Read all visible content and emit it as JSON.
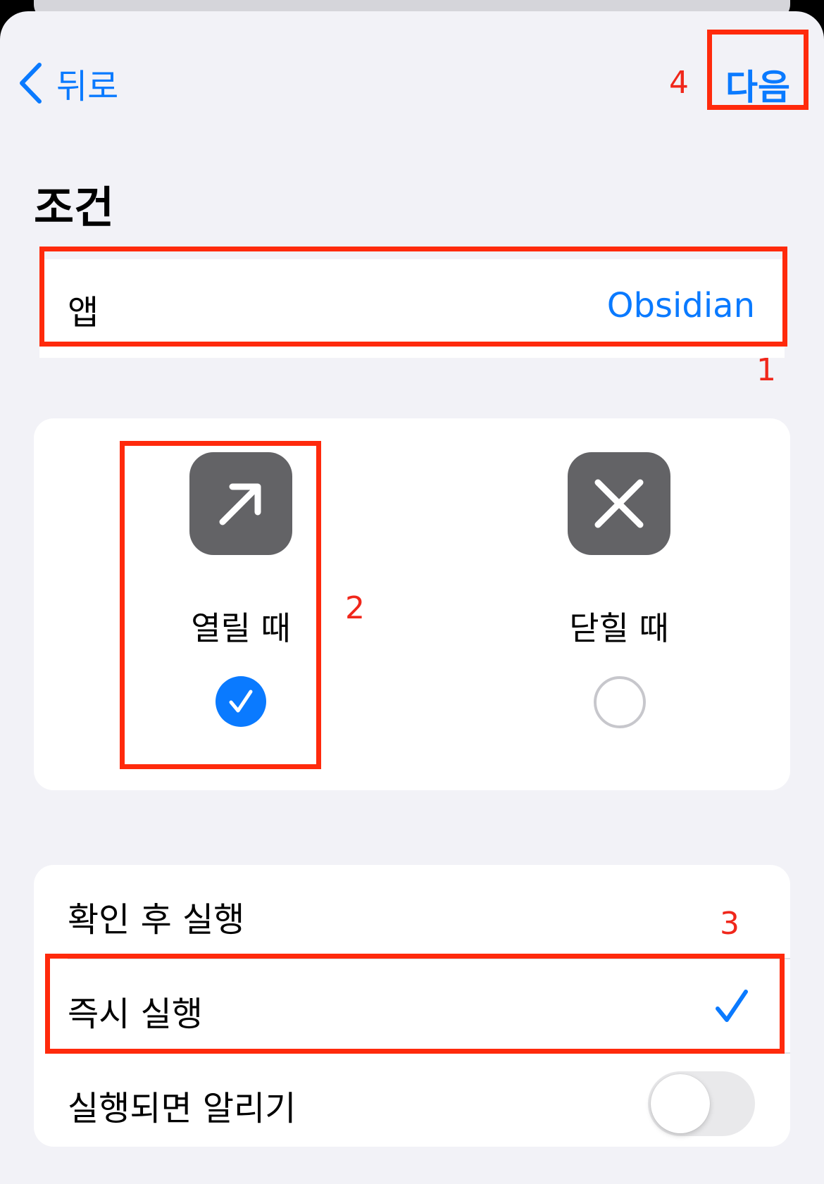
{
  "nav": {
    "back_label": "뒤로",
    "next_label": "다음"
  },
  "section": {
    "title": "조건"
  },
  "app_row": {
    "label": "앱",
    "value": "Obsidian"
  },
  "trigger_options": [
    {
      "label": "열릴 때",
      "icon": "arrow-up-right-icon",
      "selected": true
    },
    {
      "label": "닫힐 때",
      "icon": "xmark-icon",
      "selected": false
    }
  ],
  "run_options": {
    "ask_before_label": "확인 후 실행",
    "immediate_label": "즉시 실행",
    "immediate_selected": true,
    "notify_label": "실행되면 알리기",
    "notify_enabled": false
  },
  "annotations": {
    "n1": "1",
    "n2": "2",
    "n3": "3",
    "n4": "4"
  },
  "colors": {
    "accent": "#0a7aff",
    "highlight": "#ff2a0c",
    "annotation_text": "#f0271b",
    "background": "#f2f2f7",
    "icon_tile": "#636366"
  }
}
